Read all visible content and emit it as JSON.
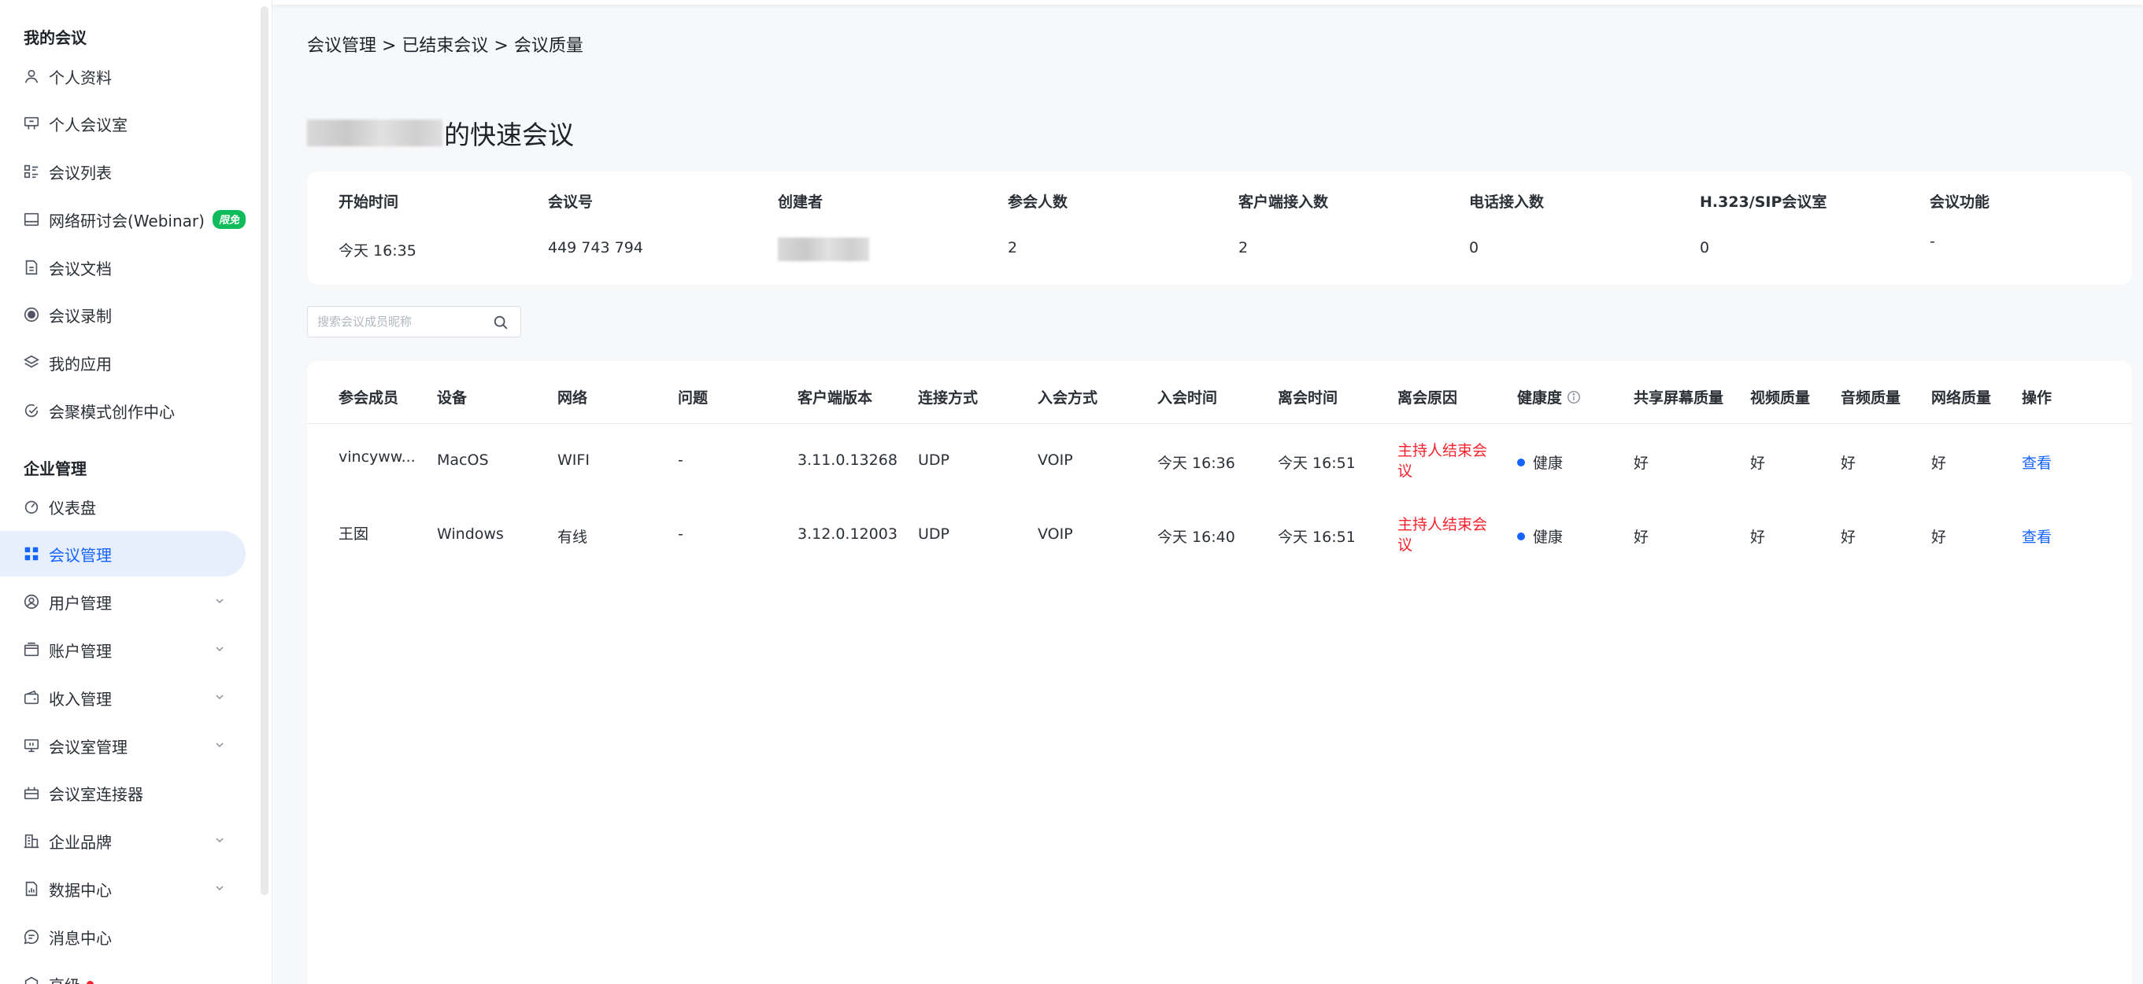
{
  "sidebar": {
    "section_mine": "我的会议",
    "mine_items": [
      {
        "label": "个人资料",
        "icon": "person-icon"
      },
      {
        "label": "个人会议室",
        "icon": "room-icon"
      },
      {
        "label": "会议列表",
        "icon": "list-icon"
      },
      {
        "label": "网络研讨会(Webinar)",
        "icon": "webinar-icon",
        "badge": "限免"
      },
      {
        "label": "会议文档",
        "icon": "document-icon"
      },
      {
        "label": "会议录制",
        "icon": "record-icon"
      },
      {
        "label": "我的应用",
        "icon": "layers-icon"
      },
      {
        "label": "会聚模式创作中心",
        "icon": "creative-icon"
      }
    ],
    "section_enterprise": "企业管理",
    "enterprise_items": [
      {
        "label": "仪表盘",
        "icon": "dashboard-icon",
        "chevron": false
      },
      {
        "label": "会议管理",
        "icon": "grid-icon",
        "chevron": false,
        "active": true
      },
      {
        "label": "用户管理",
        "icon": "user-circle-icon",
        "chevron": true
      },
      {
        "label": "账户管理",
        "icon": "wallet-icon",
        "chevron": true
      },
      {
        "label": "收入管理",
        "icon": "income-icon",
        "chevron": true
      },
      {
        "label": "会议室管理",
        "icon": "screen-icon",
        "chevron": true
      },
      {
        "label": "会议室连接器",
        "icon": "connector-icon",
        "chevron": false
      },
      {
        "label": "企业品牌",
        "icon": "building-icon",
        "chevron": true
      },
      {
        "label": "数据中心",
        "icon": "data-icon",
        "chevron": true
      },
      {
        "label": "消息中心",
        "icon": "message-icon",
        "chevron": false
      },
      {
        "label": "高级",
        "icon": "advanced-icon",
        "chevron": false
      }
    ]
  },
  "breadcrumb": "会议管理 > 已结束会议 > 会议质量",
  "meeting_title_suffix": "的快速会议",
  "info": {
    "headers": [
      "开始时间",
      "会议号",
      "创建者",
      "参会人数",
      "客户端接入数",
      "电话接入数",
      "H.323/SIP会议室",
      "会议功能"
    ],
    "values": [
      "今天  16:35",
      "449 743 794",
      "",
      "2",
      "2",
      "0",
      "0",
      "-"
    ]
  },
  "search": {
    "placeholder": "搜索会议成员昵称"
  },
  "table": {
    "headers": [
      "参会成员",
      "设备",
      "网络",
      "问题",
      "客户端版本",
      "连接方式",
      "入会方式",
      "入会时间",
      "离会时间",
      "离会原因",
      "健康度",
      "共享屏幕质量",
      "视频质量",
      "音频质量",
      "网络质量",
      "操作"
    ],
    "rows": [
      [
        "vincyww...",
        "MacOS",
        "WIFI",
        "-",
        "3.11.0.13268",
        "UDP",
        "VOIP",
        "今天  16:36",
        "今天  16:51",
        "主持人结束会议",
        "健康",
        "好",
        "好",
        "好",
        "好",
        "查看"
      ],
      [
        "王囡",
        "Windows",
        "有线",
        "-",
        "3.12.0.12003",
        "UDP",
        "VOIP",
        "今天  16:40",
        "今天  16:51",
        "主持人结束会议",
        "健康",
        "好",
        "好",
        "好",
        "好",
        "查看"
      ]
    ]
  },
  "colors": {
    "accent": "#1664ff",
    "danger": "#f5222d",
    "badge": "#0fbb5a"
  }
}
